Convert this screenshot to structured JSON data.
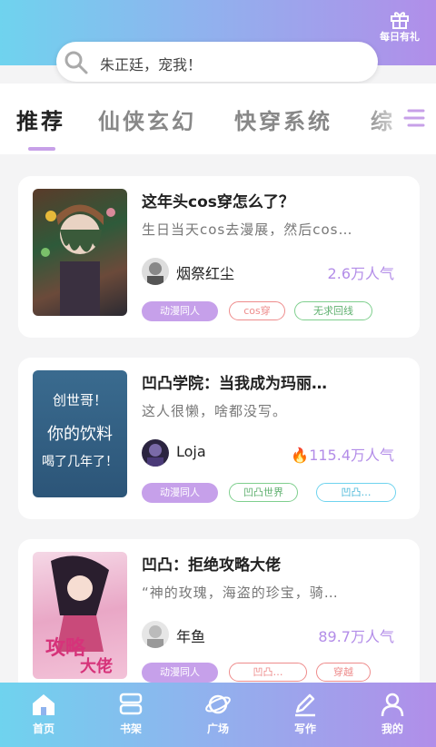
{
  "header": {
    "gift_label": "每日有礼",
    "search_text": "朱正廷，宠我！"
  },
  "tabs": [
    {
      "label": "推荐",
      "active": true
    },
    {
      "label": "仙侠玄幻",
      "active": false
    },
    {
      "label": "快穿系统",
      "active": false
    },
    {
      "label": "综",
      "active": false
    }
  ],
  "books": [
    {
      "title": "这年头cos穿怎么了？",
      "desc": "生日当天cos去漫展，然后cos…",
      "author": "烟祭红尘",
      "popularity": "2.6万人气",
      "tags": [
        {
          "label": "动漫同人",
          "style": "fill"
        },
        {
          "label": "cos穿",
          "style": "red"
        },
        {
          "label": "无求回线",
          "style": "green"
        }
      ]
    },
    {
      "title": "凹凸学院：当我成为玛丽…",
      "desc": "这人很懒，啥都没写。",
      "cover_text": [
        "创世哥！",
        "你的饮料",
        "喝了几年了！"
      ],
      "author": "Loja",
      "popularity": "115.4万人气",
      "tags": [
        {
          "label": "动漫同人",
          "style": "fill"
        },
        {
          "label": "凹凸世界",
          "style": "green"
        },
        {
          "label": "凹凸…",
          "style": "cyan"
        }
      ]
    },
    {
      "title": "凹凸：拒绝攻略大佬",
      "desc": "“神的玫瑰，海盗的珍宝，骑…",
      "cover_text": [
        "攻略",
        "大佬"
      ],
      "author": "年鱼",
      "popularity": "89.7万人气",
      "tags": [
        {
          "label": "动漫同人",
          "style": "fill"
        },
        {
          "label": "凹凸…",
          "style": "red"
        },
        {
          "label": "穿越",
          "style": "red"
        }
      ]
    }
  ],
  "bottom_nav": [
    {
      "label": "首页",
      "icon": "home-icon"
    },
    {
      "label": "书架",
      "icon": "bookshelf-icon"
    },
    {
      "label": "广场",
      "icon": "planet-icon"
    },
    {
      "label": "写作",
      "icon": "pen-icon"
    },
    {
      "label": "我的",
      "icon": "user-icon"
    }
  ],
  "colors": {
    "accent_purple": "#c6a0ea",
    "accent_cyan": "#6fd3ee",
    "popularity": "#b38de8"
  }
}
